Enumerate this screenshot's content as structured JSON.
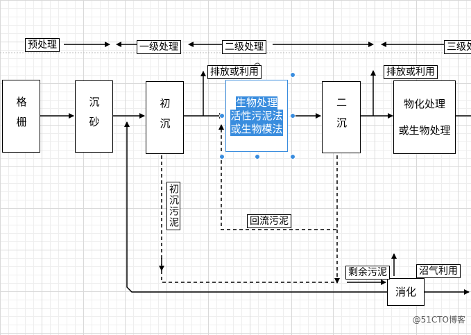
{
  "boxes": {
    "grille": "格栅",
    "grit": "沉砂",
    "primary": "初沉",
    "bio_lines": [
      "生物处理",
      "活性污泥法",
      "或生物模法"
    ],
    "secondary": "二沉",
    "physchem_lines": [
      "物化处理",
      "或生物处理"
    ],
    "digestion": "消化"
  },
  "labels": {
    "pretreat": "预处理",
    "level1": "一级处理",
    "level2": "二级处理",
    "level3": "三级处",
    "discharge1": "排放或利用",
    "discharge2": "排放或利用",
    "primary_sludge": "初沉污泥",
    "return_sludge": "回流污泥",
    "excess_sludge": "剩余污泥",
    "biogas": "沼气利用"
  },
  "watermark": "@51CTO博客"
}
